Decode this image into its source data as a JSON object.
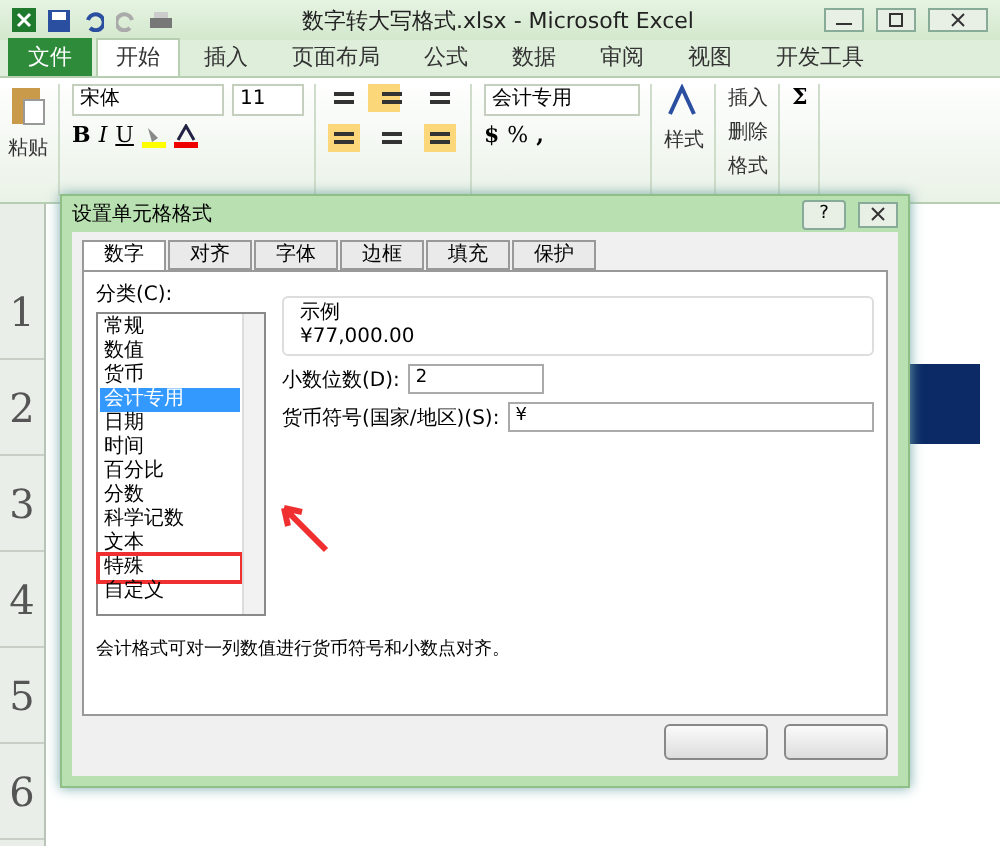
{
  "window": {
    "title": "数字转大写格式.xlsx - Microsoft Excel"
  },
  "ribbon_tabs": [
    {
      "label": "文件",
      "kind": "file",
      "selected": false
    },
    {
      "label": "开始",
      "kind": "tab",
      "selected": true
    },
    {
      "label": "插入",
      "kind": "tab",
      "selected": false
    },
    {
      "label": "页面布局",
      "kind": "tab",
      "selected": false
    },
    {
      "label": "公式",
      "kind": "tab",
      "selected": false
    },
    {
      "label": "数据",
      "kind": "tab",
      "selected": false
    },
    {
      "label": "审阅",
      "kind": "tab",
      "selected": false
    },
    {
      "label": "视图",
      "kind": "tab",
      "selected": false
    },
    {
      "label": "开发工具",
      "kind": "tab",
      "selected": false
    }
  ],
  "ribbon": {
    "paste": "粘贴",
    "font_name": "宋体",
    "font_size": "11",
    "bold": "B",
    "italic": "I",
    "underline": "U",
    "number_format": "会计专用",
    "currency": "$",
    "percent": "%",
    "comma": ",",
    "styles": "样式",
    "cells": [
      "插入",
      "删除",
      "格式"
    ],
    "sum": "Σ"
  },
  "sheet": {
    "row_headers": [
      "1",
      "2",
      "3",
      "4",
      "5",
      "6"
    ]
  },
  "dialog": {
    "title": "设置单元格格式",
    "help": "?",
    "tabs": [
      {
        "label": "数字",
        "selected": true
      },
      {
        "label": "对齐",
        "selected": false
      },
      {
        "label": "字体",
        "selected": false
      },
      {
        "label": "边框",
        "selected": false
      },
      {
        "label": "填充",
        "selected": false
      },
      {
        "label": "保护",
        "selected": false
      }
    ],
    "category_label": "分类(C):",
    "categories": [
      {
        "label": "常规",
        "selected": false,
        "highlighted": false
      },
      {
        "label": "数值",
        "selected": false,
        "highlighted": false
      },
      {
        "label": "货币",
        "selected": false,
        "highlighted": false
      },
      {
        "label": "会计专用",
        "selected": true,
        "highlighted": false
      },
      {
        "label": "日期",
        "selected": false,
        "highlighted": false
      },
      {
        "label": "时间",
        "selected": false,
        "highlighted": false
      },
      {
        "label": "百分比",
        "selected": false,
        "highlighted": false
      },
      {
        "label": "分数",
        "selected": false,
        "highlighted": false
      },
      {
        "label": "科学记数",
        "selected": false,
        "highlighted": false
      },
      {
        "label": "文本",
        "selected": false,
        "highlighted": false
      },
      {
        "label": "特殊",
        "selected": false,
        "highlighted": true
      },
      {
        "label": "自定义",
        "selected": false,
        "highlighted": false
      }
    ],
    "sample_label": "示例",
    "sample_value": "¥77,000.00",
    "decimal_label": "小数位数(D):",
    "decimal_value": "2",
    "currency_label": "货币符号(国家/地区)(S):",
    "currency_value": "¥",
    "description": "会计格式可对一列数值进行货币符号和小数点对齐。"
  }
}
